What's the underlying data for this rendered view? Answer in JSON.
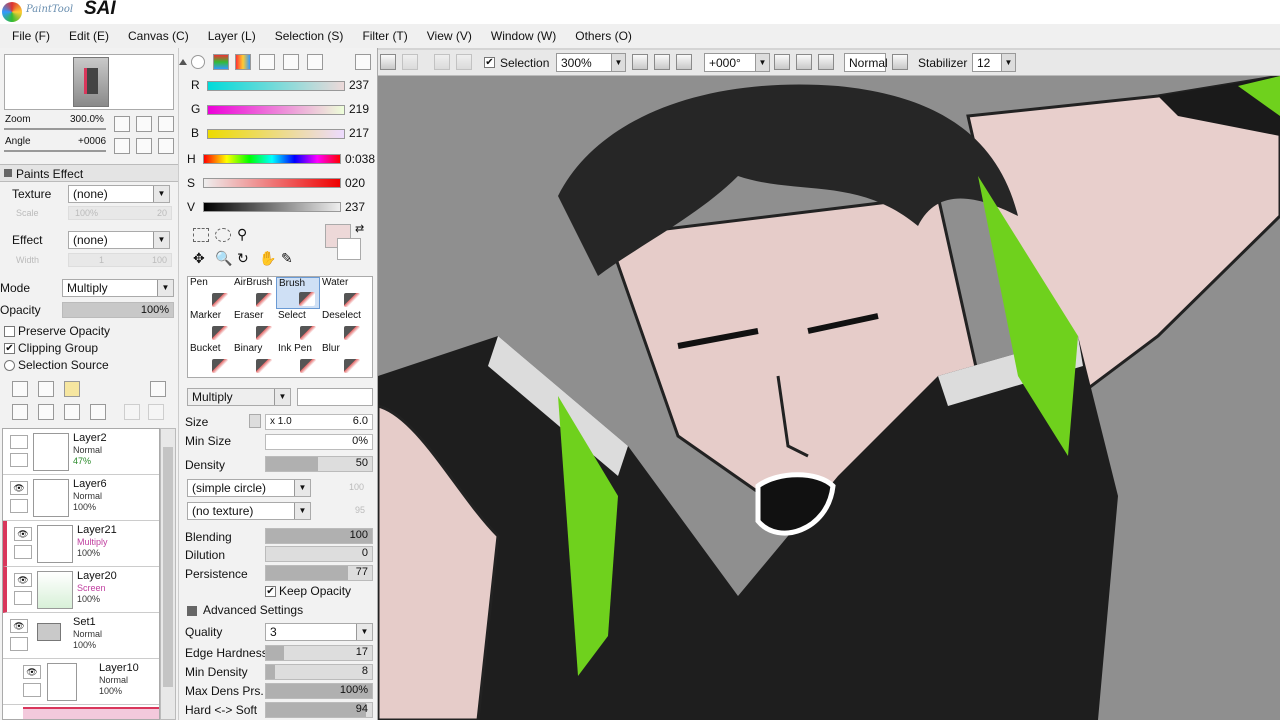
{
  "app": {
    "name": "SAI",
    "prefix": "PaintTool"
  },
  "menu": [
    "File (F)",
    "Edit (E)",
    "Canvas (C)",
    "Layer (L)",
    "Selection (S)",
    "Filter (T)",
    "View (V)",
    "Window (W)",
    "Others (O)"
  ],
  "toolbar": {
    "selection_label": "Selection",
    "selection_checked": true,
    "zoom": "300%",
    "angle": "+000°",
    "blend": "Normal",
    "stabilizer_label": "Stabilizer",
    "stabilizer": "12"
  },
  "navigator": {
    "zoom_label": "Zoom",
    "zoom_value": "300.0%",
    "angle_label": "Angle",
    "angle_value": "+0006"
  },
  "paints_effect": {
    "header": "Paints Effect",
    "texture_label": "Texture",
    "texture_value": "(none)",
    "scale_label": "Scale",
    "scale_value": "100%",
    "scale_num": "20",
    "effect_label": "Effect",
    "effect_value": "(none)",
    "width_label": "Width",
    "width_value": "1",
    "width_num": "100"
  },
  "layer_props": {
    "mode_label": "Mode",
    "mode_value": "Multiply",
    "opacity_label": "Opacity",
    "opacity_value": "100%",
    "preserve_opacity": "Preserve Opacity",
    "clipping_group": "Clipping Group",
    "selection_source": "Selection Source"
  },
  "layers": [
    {
      "name": "Layer2",
      "mode": "Normal",
      "opacity": "47%",
      "visible": false
    },
    {
      "name": "Layer6",
      "mode": "Normal",
      "opacity": "100%",
      "visible": true
    },
    {
      "name": "Layer21",
      "mode": "Multiply",
      "opacity": "100%",
      "visible": true
    },
    {
      "name": "Layer20",
      "mode": "Screen",
      "opacity": "100%",
      "visible": true
    },
    {
      "name": "Set1",
      "mode": "Normal",
      "opacity": "100%",
      "visible": true
    },
    {
      "name": "Layer10",
      "mode": "Normal",
      "opacity": "100%",
      "visible": true
    }
  ],
  "color": {
    "r_label": "R",
    "r": "237",
    "g_label": "G",
    "g": "219",
    "b_label": "B",
    "b": "217",
    "h_label": "H",
    "h": "0:038",
    "s_label": "S",
    "s": "020",
    "v_label": "V",
    "v": "237",
    "current": "#edd8d8",
    "r_frac": 0.93,
    "g_frac": 0.86,
    "b_frac": 0.85,
    "h_frac": 0.99,
    "s_frac": 0.08,
    "v_frac": 0.93
  },
  "tools": [
    {
      "label": "Pen"
    },
    {
      "label": "AirBrush"
    },
    {
      "label": "Brush",
      "active": true
    },
    {
      "label": "Water"
    },
    {
      "label": "Marker"
    },
    {
      "label": "Eraser"
    },
    {
      "label": "Select"
    },
    {
      "label": "Deselect"
    },
    {
      "label": "Bucket"
    },
    {
      "label": "Binary"
    },
    {
      "label": "Ink Pen"
    },
    {
      "label": "Blur"
    }
  ],
  "brush": {
    "blend_mode": "Multiply",
    "size_label": "Size",
    "size_mult": "x 1.0",
    "size_value": "6.0",
    "min_size_label": "Min Size",
    "min_size_value": "0%",
    "density_label": "Density",
    "density_value": "50",
    "shape": "(simple circle)",
    "shape_num": "100",
    "texture": "(no texture)",
    "texture_num": "95",
    "blending_label": "Blending",
    "blending_value": "100",
    "dilution_label": "Dilution",
    "dilution_value": "0",
    "persistence_label": "Persistence",
    "persistence_value": "77",
    "keep_opacity": "Keep Opacity",
    "advanced_label": "Advanced Settings",
    "quality_label": "Quality",
    "quality_value": "3",
    "edge_label": "Edge Hardness",
    "edge_value": "17",
    "min_density_label": "Min Density",
    "min_density_value": "8",
    "max_dens_label": "Max Dens Prs.",
    "max_dens_value": "100%",
    "hard_soft_label": "Hard <-> Soft",
    "hard_soft_value": "94"
  }
}
